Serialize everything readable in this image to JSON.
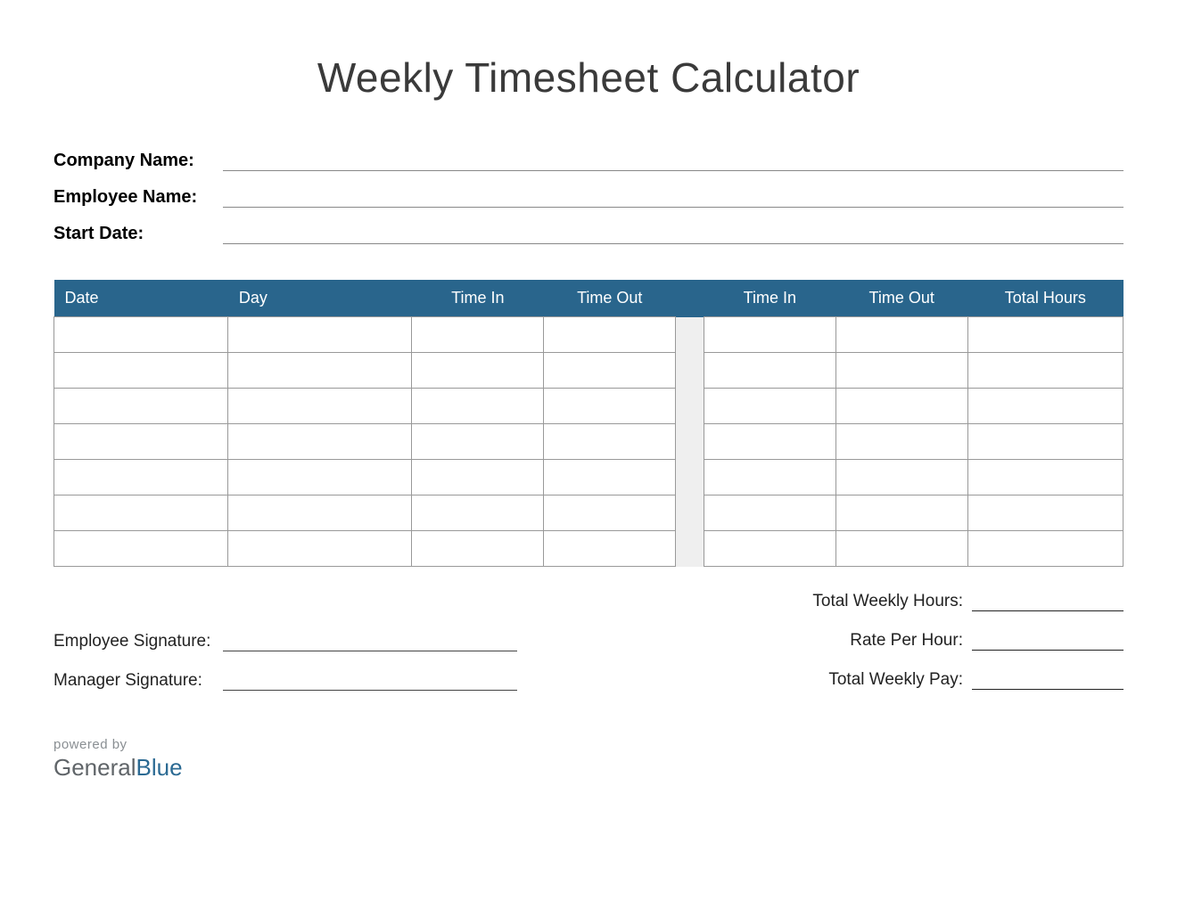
{
  "title": "Weekly Timesheet Calculator",
  "info": {
    "company_label": "Company Name:",
    "employee_label": "Employee Name:",
    "startdate_label": "Start Date:"
  },
  "table": {
    "headers": {
      "date": "Date",
      "day": "Day",
      "time_in_1": "Time In",
      "time_out_1": "Time Out",
      "time_in_2": "Time In",
      "time_out_2": "Time Out",
      "total": "Total Hours"
    },
    "row_count": 7
  },
  "signatures": {
    "employee": "Employee Signature:",
    "manager": "Manager Signature:"
  },
  "totals": {
    "weekly_hours": "Total Weekly Hours:",
    "rate": "Rate Per Hour:",
    "weekly_pay": "Total Weekly Pay:"
  },
  "footer": {
    "powered": "powered by",
    "brand_a": "General",
    "brand_b": "Blue"
  }
}
